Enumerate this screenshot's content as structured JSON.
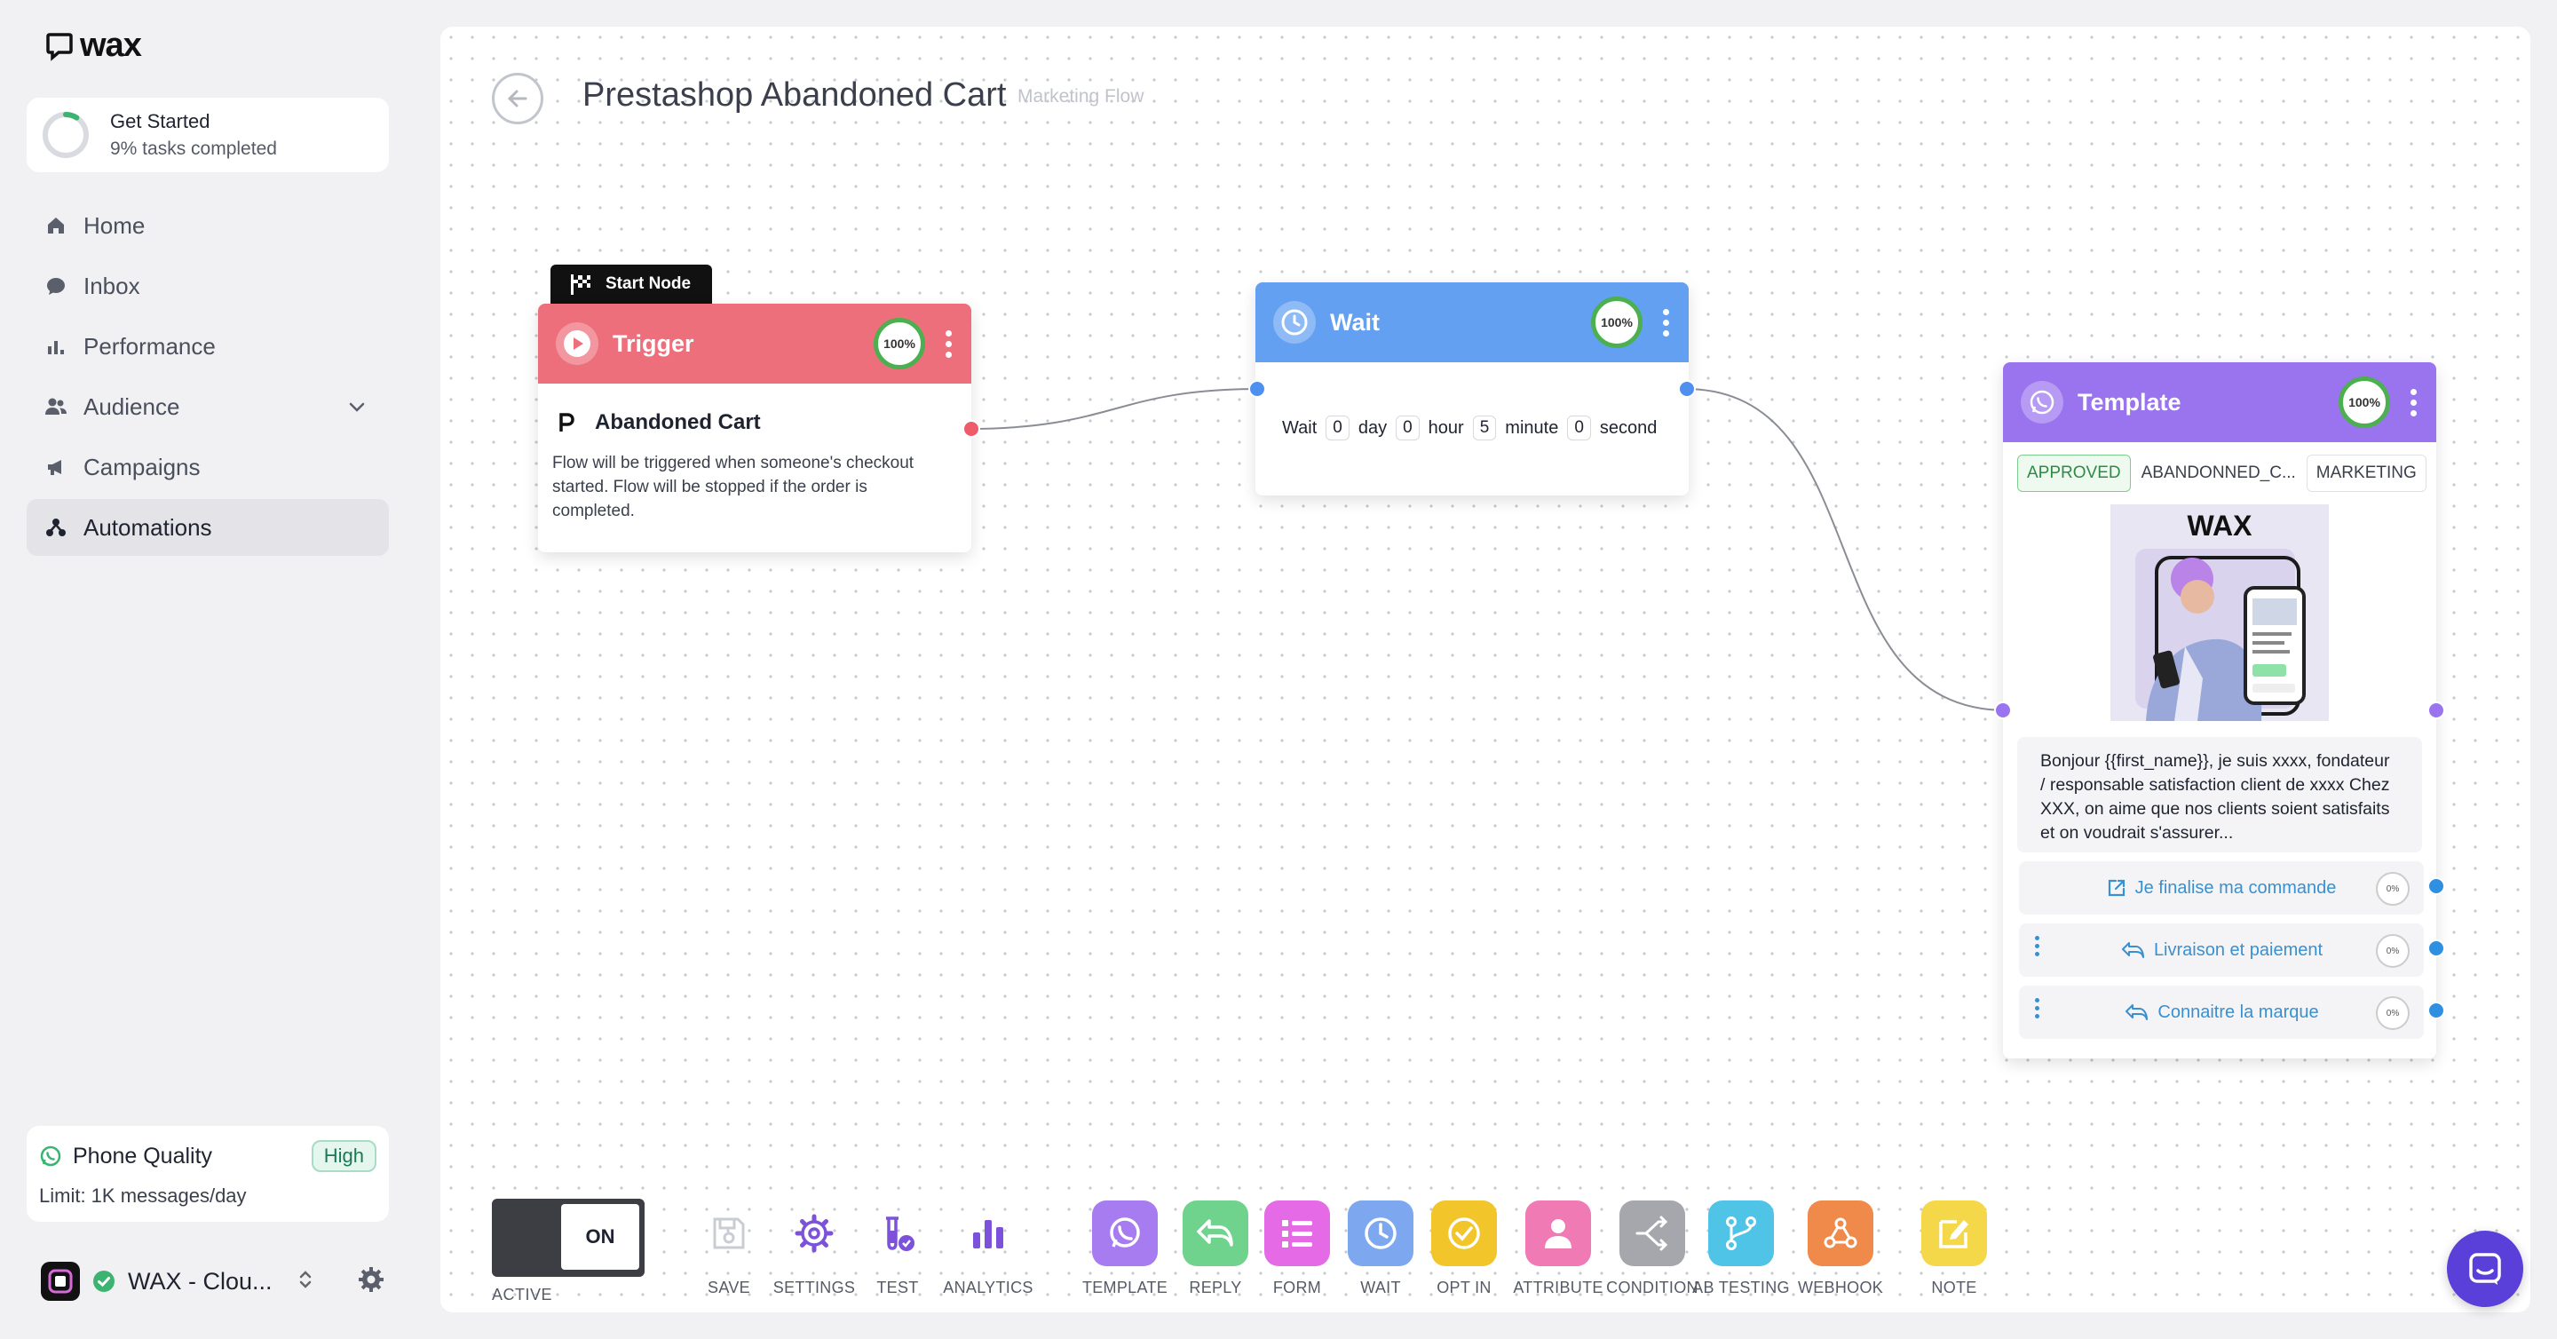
{
  "app": {
    "logo_text": "wax"
  },
  "get_started": {
    "title": "Get Started",
    "subtitle": "9% tasks completed",
    "progress_percent": 9
  },
  "nav": {
    "items": [
      {
        "label": "Home",
        "icon": "home-icon"
      },
      {
        "label": "Inbox",
        "icon": "chat-icon"
      },
      {
        "label": "Performance",
        "icon": "bar-chart-icon"
      },
      {
        "label": "Audience",
        "icon": "users-icon"
      },
      {
        "label": "Campaigns",
        "icon": "megaphone-icon"
      },
      {
        "label": "Automations",
        "icon": "automation-icon",
        "active": true
      }
    ]
  },
  "phone_quality": {
    "title": "Phone Quality",
    "badge": "High",
    "limit": "Limit: 1K messages/day"
  },
  "account": {
    "name": "WAX - Clou..."
  },
  "flow": {
    "title": "Prestashop Abandoned Cart",
    "subtitle": "Marketing Flow"
  },
  "nodes": {
    "start_tag": "Start Node",
    "trigger": {
      "title": "Trigger",
      "percent": "100%",
      "source_title": "Abandoned Cart",
      "description": "Flow will be triggered when someone's checkout started. Flow will be stopped if the order is completed.",
      "color": "#ee6f7c"
    },
    "wait": {
      "title": "Wait",
      "percent": "100%",
      "prefix": "Wait",
      "day_value": "0",
      "day_label": "day",
      "hour_value": "0",
      "hour_label": "hour",
      "minute_value": "5",
      "minute_label": "minute",
      "second_value": "0",
      "second_label": "second",
      "color": "#63a0f1"
    },
    "template": {
      "title": "Template",
      "percent": "100%",
      "status": "APPROVED",
      "name": "ABANDONNED_C...",
      "category": "MARKETING",
      "image_brand": "WAX",
      "message": "Bonjour {{first_name}}, je suis xxxx, fondateur / responsable satisfaction client de xxxx Chez XXX, on aime que nos clients soient satisfaits et on voudrait s'assurer...",
      "buttons": [
        {
          "label": "Je finalise ma commande",
          "percent": "0%",
          "icon": "external-link-icon"
        },
        {
          "label": "Livraison et paiement",
          "percent": "0%",
          "icon": "reply-icon"
        },
        {
          "label": "Connaitre la marque",
          "percent": "0%",
          "icon": "reply-icon"
        }
      ],
      "color": "#9a73ef"
    }
  },
  "toolbar": {
    "toggle_state": "ON",
    "toggle_label": "ACTIVE",
    "tools": [
      {
        "label": "SAVE",
        "icon": "save-icon"
      },
      {
        "label": "SETTINGS",
        "icon": "gear-icon"
      },
      {
        "label": "TEST",
        "icon": "flask-icon"
      },
      {
        "label": "ANALYTICS",
        "icon": "bar-chart-icon"
      },
      {
        "label": "TEMPLATE",
        "icon": "whatsapp-icon",
        "color": "#a77cf0"
      },
      {
        "label": "REPLY",
        "icon": "reply-icon",
        "color": "#6fd38e"
      },
      {
        "label": "FORM",
        "icon": "form-icon",
        "color": "#e56be6"
      },
      {
        "label": "WAIT",
        "icon": "clock-icon",
        "color": "#7da8ef"
      },
      {
        "label": "OPT IN",
        "icon": "check-circle-icon",
        "color": "#f2c52a"
      },
      {
        "label": "ATTRIBUTE",
        "icon": "user-icon",
        "color": "#f07ab3"
      },
      {
        "label": "CONDITION",
        "icon": "shuffle-icon",
        "color": "#a5a7ad"
      },
      {
        "label": "AB TESTING",
        "icon": "branch-icon",
        "color": "#4fc4e6"
      },
      {
        "label": "WEBHOOK",
        "icon": "webhook-icon",
        "color": "#f08a4a"
      },
      {
        "label": "NOTE",
        "icon": "note-icon",
        "color": "#f5d84a"
      }
    ]
  }
}
